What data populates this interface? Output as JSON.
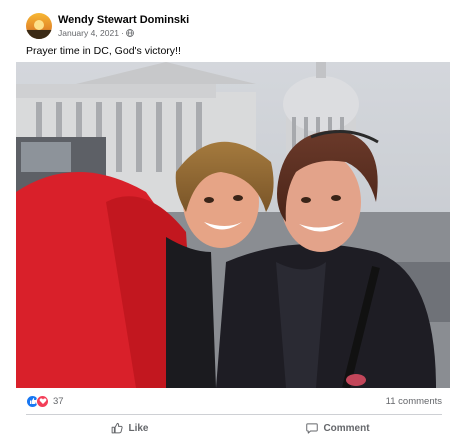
{
  "post": {
    "author": "Wendy Stewart Dominski",
    "date": "January 4, 2021",
    "separator": "·",
    "privacy_icon": "globe-icon",
    "text": "Prayer time in DC, God's victory!!",
    "photo_alt": "Two women taking a selfie in front of the U.S. Capitol"
  },
  "stats": {
    "reactions": [
      "like",
      "love"
    ],
    "reaction_count": "37",
    "comments": "11 comments"
  },
  "actions": {
    "like_label": "Like",
    "comment_label": "Comment"
  },
  "colors": {
    "like_blue": "#1877f2",
    "love_red": "#f33e58",
    "secondary_text": "#65676b"
  }
}
